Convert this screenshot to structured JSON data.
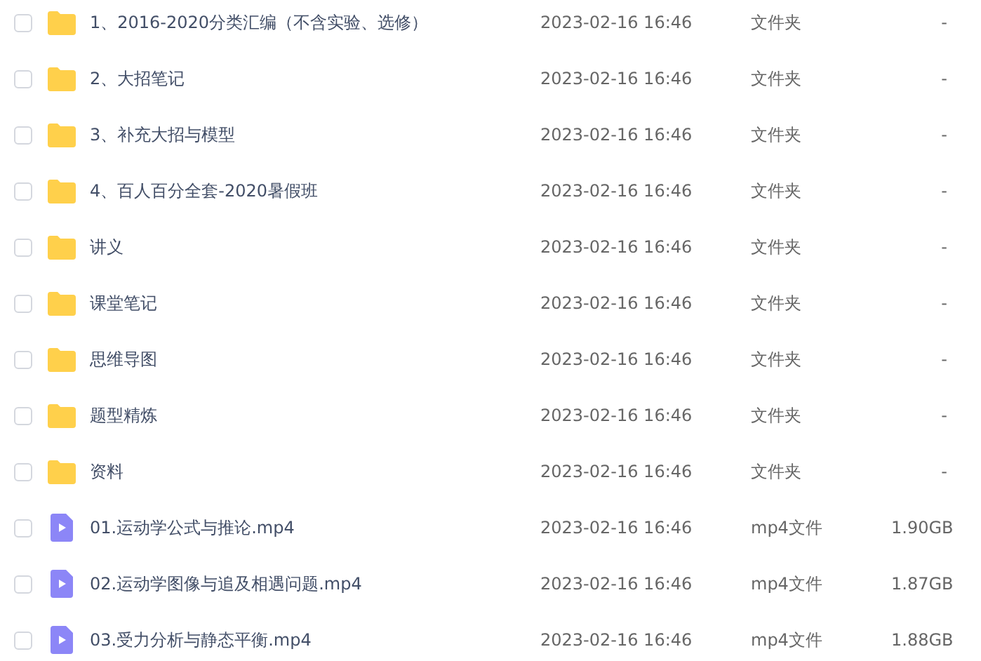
{
  "files": [
    {
      "kind": "folder",
      "checked": false,
      "name": "1、2016-2020分类汇编（不含实验、选修）",
      "modified": "2023-02-16 16:46",
      "type": "文件夹",
      "size": "-"
    },
    {
      "kind": "folder",
      "checked": false,
      "name": "2、大招笔记",
      "modified": "2023-02-16 16:46",
      "type": "文件夹",
      "size": "-"
    },
    {
      "kind": "folder",
      "checked": false,
      "name": "3、补充大招与模型",
      "modified": "2023-02-16 16:46",
      "type": "文件夹",
      "size": "-"
    },
    {
      "kind": "folder",
      "checked": false,
      "name": "4、百人百分全套-2020暑假班",
      "modified": "2023-02-16 16:46",
      "type": "文件夹",
      "size": "-"
    },
    {
      "kind": "folder",
      "checked": false,
      "name": "讲义",
      "modified": "2023-02-16 16:46",
      "type": "文件夹",
      "size": "-"
    },
    {
      "kind": "folder",
      "checked": false,
      "name": "课堂笔记",
      "modified": "2023-02-16 16:46",
      "type": "文件夹",
      "size": "-"
    },
    {
      "kind": "folder",
      "checked": false,
      "name": "思维导图",
      "modified": "2023-02-16 16:46",
      "type": "文件夹",
      "size": "-"
    },
    {
      "kind": "folder",
      "checked": false,
      "name": "题型精炼",
      "modified": "2023-02-16 16:46",
      "type": "文件夹",
      "size": "-"
    },
    {
      "kind": "folder",
      "checked": false,
      "name": "资料",
      "modified": "2023-02-16 16:46",
      "type": "文件夹",
      "size": "-"
    },
    {
      "kind": "video",
      "checked": false,
      "name": "01.运动学公式与推论.mp4",
      "modified": "2023-02-16 16:46",
      "type": "mp4文件",
      "size": "1.90GB"
    },
    {
      "kind": "video",
      "checked": false,
      "name": "02.运动学图像与追及相遇问题.mp4",
      "modified": "2023-02-16 16:46",
      "type": "mp4文件",
      "size": "1.87GB"
    },
    {
      "kind": "video",
      "checked": false,
      "name": "03.受力分析与静态平衡.mp4",
      "modified": "2023-02-16 16:46",
      "type": "mp4文件",
      "size": "1.88GB"
    }
  ]
}
